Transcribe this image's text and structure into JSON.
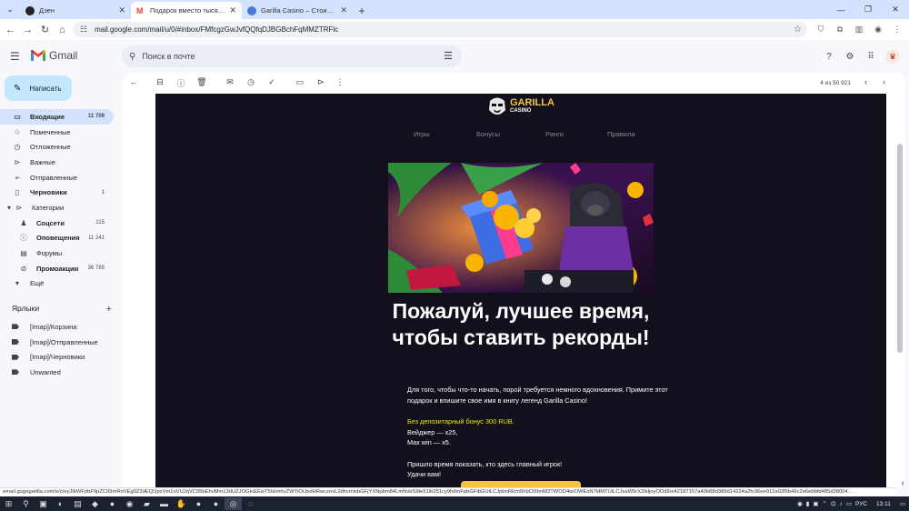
{
  "browser": {
    "tabs": [
      {
        "title": "Дзен",
        "fav_color": "#222222"
      },
      {
        "title": "Подарок вместо тысячи слов: …",
        "fav_color": "#ea4335"
      },
      {
        "title": "Garilla Casino – Стоит попробов…",
        "fav_color": "#4a7bd1"
      }
    ],
    "new_tab": "+",
    "url": "mail.google.com/mail/u/0/#inbox/FMfcgzGwJvfQQfqDJBGBchFqMMZTRFlc"
  },
  "gmail": {
    "product": "Gmail",
    "search_placeholder": "Поиск в почте",
    "compose": "Написать",
    "nav": [
      {
        "label": "Входящие",
        "count": "11 709",
        "icon": "▭"
      },
      {
        "label": "Помеченные",
        "count": "",
        "icon": "☆"
      },
      {
        "label": "Отложенные",
        "count": "",
        "icon": "◷"
      },
      {
        "label": "Важные",
        "count": "",
        "icon": "⊳"
      },
      {
        "label": "Отправленные",
        "count": "",
        "icon": "➢"
      },
      {
        "label": "Черновики",
        "count": "1",
        "icon": "▯"
      },
      {
        "label": "Категории",
        "count": "",
        "icon": "▾"
      }
    ],
    "categories": [
      {
        "label": "Соцсети",
        "count": "115",
        "icon": "♟"
      },
      {
        "label": "Оповещения",
        "count": "11 241",
        "icon": "ⓘ"
      },
      {
        "label": "Форумы",
        "count": "",
        "icon": "▤"
      },
      {
        "label": "Промоакции",
        "count": "36 785",
        "icon": "⊘"
      }
    ],
    "more": "Ещё",
    "labels_title": "Ярлыки",
    "labels": [
      "[Imap]/Корзина",
      "[Imap]/Отправленные",
      "[Imap]/Черновики",
      "Unwanted"
    ],
    "pager": "4 из 50 921"
  },
  "email": {
    "brand_top": "GARILLA",
    "brand_bottom": "CASINO",
    "menu": [
      "Игры",
      "Бонусы",
      "Ранги",
      "Правила"
    ],
    "headline": "Пожалуй, лучшее время, чтобы ставить рекорды!",
    "para1": "Для того, чтобы что-то начать, порой требуется немного вдохновения. Примите этот подарок и впишите свое имя в книгу легенд Garilla Casino!",
    "bonus": "Без депозитарный бонус 300 RUB.",
    "wager": "Вейджер — x25,",
    "maxwin": "Max win — x5.",
    "para3_line1": "Пришло время показать, кто здесь главный игрок!",
    "para3_line2": "Удачи вам!"
  },
  "status_url": "email.gogogarilla.com/e/c/eyJlbWFpbF9pZCI6ImRnVEg0Z2dEQUpzVm1oVUJqVC05bEhvMm13dUZJOGtcEEwT5lsImhyZWYiOiJodHRwczovL2dhcmlsbGFjYXNpbm84LmNvbS9te51ib251cy9hdmFpbGFibGUiLCJpbnRlcm5hbCI6ImM3TWOD4wiOWEsN7ldMTUiLCJsaW5rX2lkIjoyODd9/e42187157a40b88d389d14224a2fc06ee912a02f6b46c2e6ebbfd485d38004…",
  "taskbar": {
    "lang": "РУС",
    "time": "13:11"
  },
  "colors": {
    "accent": "#c2e7ff",
    "active_nav": "#d3e3fd",
    "email_bg": "#12101c",
    "gold": "#f4c542",
    "bonus_yellow": "#f2e600"
  }
}
